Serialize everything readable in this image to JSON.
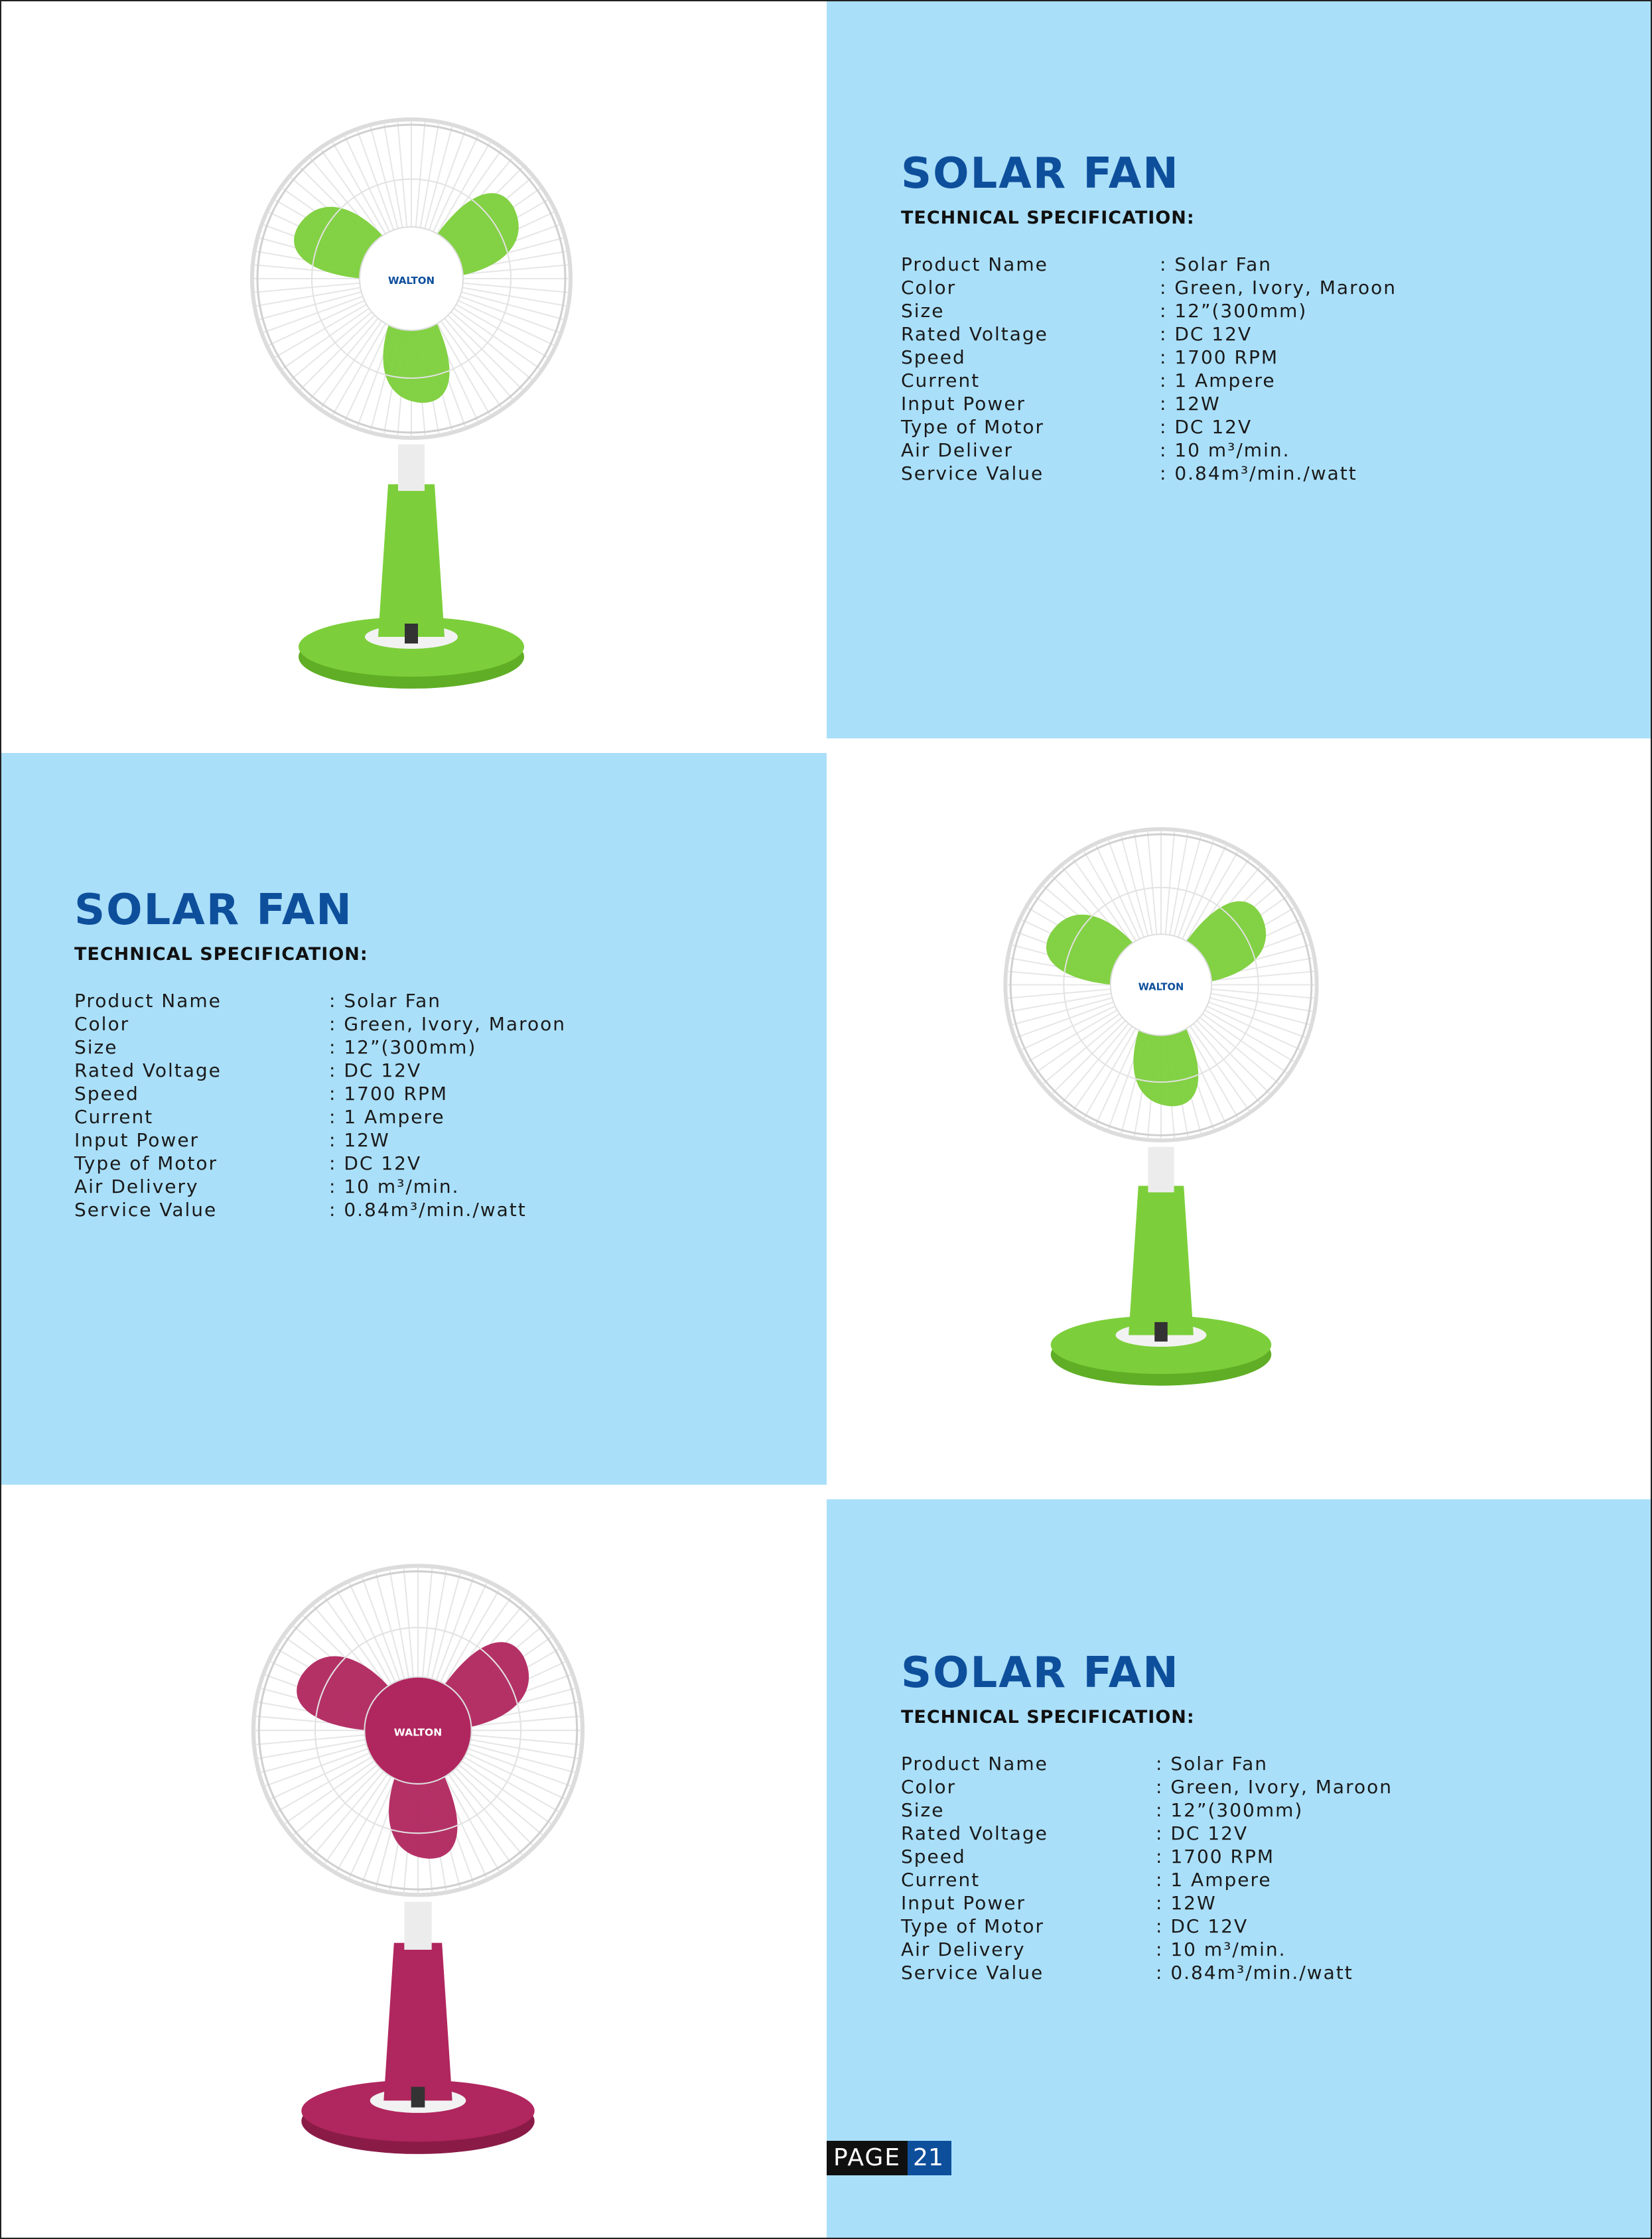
{
  "page": {
    "label": "PAGE",
    "number": "21"
  },
  "colors": {
    "panel": "#aadff9",
    "title": "#0e4f9c",
    "green": "#7ccf3a",
    "maroon": "#b0265e"
  },
  "sections": [
    {
      "title": "SOLAR FAN",
      "subtitle": "TECHNICAL SPECIFICATION:",
      "specs": [
        {
          "label": "Product Name",
          "value": ": Solar Fan"
        },
        {
          "label": "Color",
          "value": ": Green, Ivory, Maroon"
        },
        {
          "label": "Size",
          "value": ": 12”(300mm)"
        },
        {
          "label": "Rated Voltage",
          "value": ": DC 12V"
        },
        {
          "label": "Speed",
          "value": ": 1700 RPM"
        },
        {
          "label": "Current",
          "value": ": 1 Ampere"
        },
        {
          "label": "Input Power",
          "value": ": 12W"
        },
        {
          "label": "Type of Motor",
          "value": ": DC 12V"
        },
        {
          "label": "Air Deliver",
          "value": ": 10 m³/min."
        },
        {
          "label": "Service Value",
          "value": ": 0.84m³/min./watt"
        }
      ]
    },
    {
      "title": "SOLAR FAN",
      "subtitle": "TECHNICAL SPECIFICATION:",
      "specs": [
        {
          "label": "Product Name",
          "value": ": Solar Fan"
        },
        {
          "label": "Color",
          "value": ": Green, Ivory, Maroon"
        },
        {
          "label": "Size",
          "value": ": 12”(300mm)"
        },
        {
          "label": "Rated Voltage",
          "value": ": DC 12V"
        },
        {
          "label": "Speed",
          "value": ": 1700 RPM"
        },
        {
          "label": "Current",
          "value": ": 1 Ampere"
        },
        {
          "label": "Input Power",
          "value": ": 12W"
        },
        {
          "label": "Type of Motor",
          "value": ": DC 12V"
        },
        {
          "label": "Air Delivery",
          "value": ": 10 m³/min."
        },
        {
          "label": "Service Value",
          "value": ": 0.84m³/min./watt"
        }
      ]
    },
    {
      "title": "SOLAR FAN",
      "subtitle": "TECHNICAL SPECIFICATION:",
      "specs": [
        {
          "label": "Product Name",
          "value": ": Solar Fan"
        },
        {
          "label": "Color",
          "value": ": Green, Ivory, Maroon"
        },
        {
          "label": "Size",
          "value": ": 12”(300mm)"
        },
        {
          "label": "Rated Voltage",
          "value": ": DC 12V"
        },
        {
          "label": "Speed",
          "value": ": 1700 RPM"
        },
        {
          "label": "Current",
          "value": ": 1 Ampere"
        },
        {
          "label": "Input Power",
          "value": ": 12W"
        },
        {
          "label": "Type of Motor",
          "value": ": DC 12V"
        },
        {
          "label": "Air Delivery",
          "value": ": 10 m³/min."
        },
        {
          "label": "Service Value",
          "value": ": 0.84m³/min./watt"
        }
      ]
    }
  ],
  "fans": [
    {
      "color": "green",
      "logo": "WALTON"
    },
    {
      "color": "green",
      "logo": "WALTON"
    },
    {
      "color": "maroon",
      "logo": "WALTON"
    }
  ]
}
